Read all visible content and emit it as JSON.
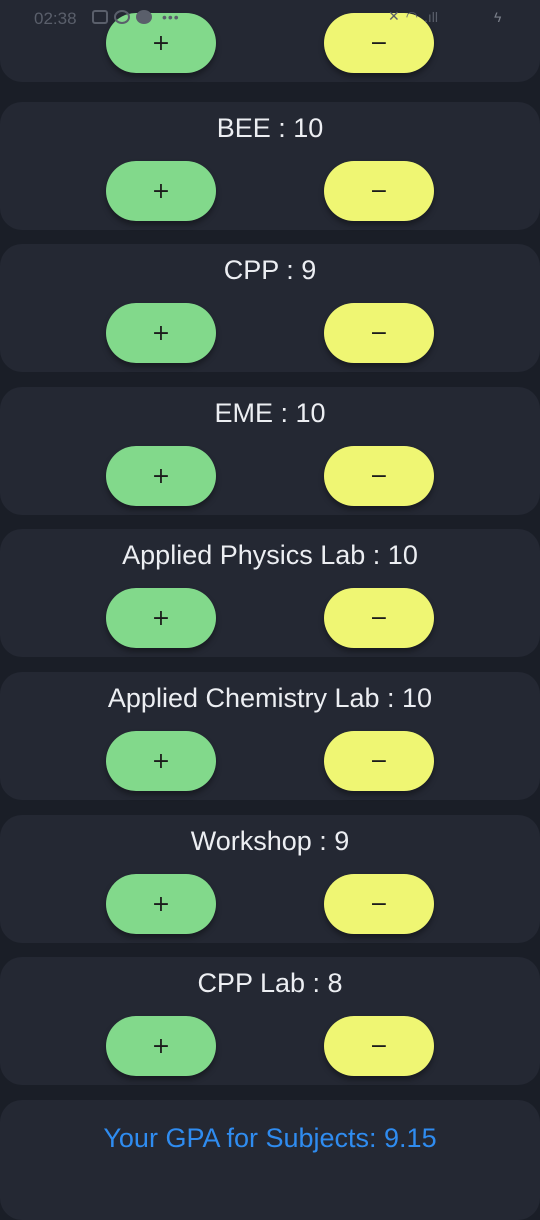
{
  "status_bar": {
    "time": "02:38",
    "dots": "•••",
    "signal": ".ıll"
  },
  "subjects": [
    {
      "label": "",
      "plus": "+",
      "minus": "−"
    },
    {
      "label": "BEE : 10",
      "plus": "+",
      "minus": "−"
    },
    {
      "label": "CPP : 9",
      "plus": "+",
      "minus": "−"
    },
    {
      "label": "EME : 10",
      "plus": "+",
      "minus": "−"
    },
    {
      "label": "Applied Physics Lab : 10",
      "plus": "+",
      "minus": "−"
    },
    {
      "label": "Applied Chemistry Lab : 10",
      "plus": "+",
      "minus": "−"
    },
    {
      "label": "Workshop : 9",
      "plus": "+",
      "minus": "−"
    },
    {
      "label": "CPP Lab : 8",
      "plus": "+",
      "minus": "−"
    }
  ],
  "gpa": {
    "text": "Your GPA for Subjects: 9.15"
  },
  "colors": {
    "background": "#1a1e27",
    "card": "#242833",
    "plus_button": "#82d98b",
    "minus_button": "#eff673",
    "gpa_text": "#2f8cf0"
  }
}
